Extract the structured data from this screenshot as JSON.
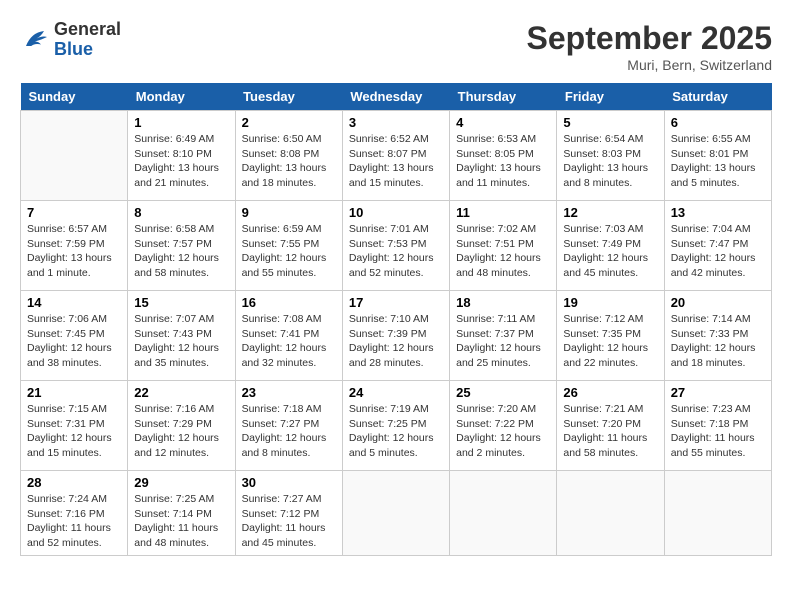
{
  "header": {
    "logo_general": "General",
    "logo_blue": "Blue",
    "month_title": "September 2025",
    "location": "Muri, Bern, Switzerland"
  },
  "days_of_week": [
    "Sunday",
    "Monday",
    "Tuesday",
    "Wednesday",
    "Thursday",
    "Friday",
    "Saturday"
  ],
  "weeks": [
    [
      {
        "date": "",
        "info": ""
      },
      {
        "date": "1",
        "info": "Sunrise: 6:49 AM\nSunset: 8:10 PM\nDaylight: 13 hours\nand 21 minutes."
      },
      {
        "date": "2",
        "info": "Sunrise: 6:50 AM\nSunset: 8:08 PM\nDaylight: 13 hours\nand 18 minutes."
      },
      {
        "date": "3",
        "info": "Sunrise: 6:52 AM\nSunset: 8:07 PM\nDaylight: 13 hours\nand 15 minutes."
      },
      {
        "date": "4",
        "info": "Sunrise: 6:53 AM\nSunset: 8:05 PM\nDaylight: 13 hours\nand 11 minutes."
      },
      {
        "date": "5",
        "info": "Sunrise: 6:54 AM\nSunset: 8:03 PM\nDaylight: 13 hours\nand 8 minutes."
      },
      {
        "date": "6",
        "info": "Sunrise: 6:55 AM\nSunset: 8:01 PM\nDaylight: 13 hours\nand 5 minutes."
      }
    ],
    [
      {
        "date": "7",
        "info": "Sunrise: 6:57 AM\nSunset: 7:59 PM\nDaylight: 13 hours\nand 1 minute."
      },
      {
        "date": "8",
        "info": "Sunrise: 6:58 AM\nSunset: 7:57 PM\nDaylight: 12 hours\nand 58 minutes."
      },
      {
        "date": "9",
        "info": "Sunrise: 6:59 AM\nSunset: 7:55 PM\nDaylight: 12 hours\nand 55 minutes."
      },
      {
        "date": "10",
        "info": "Sunrise: 7:01 AM\nSunset: 7:53 PM\nDaylight: 12 hours\nand 52 minutes."
      },
      {
        "date": "11",
        "info": "Sunrise: 7:02 AM\nSunset: 7:51 PM\nDaylight: 12 hours\nand 48 minutes."
      },
      {
        "date": "12",
        "info": "Sunrise: 7:03 AM\nSunset: 7:49 PM\nDaylight: 12 hours\nand 45 minutes."
      },
      {
        "date": "13",
        "info": "Sunrise: 7:04 AM\nSunset: 7:47 PM\nDaylight: 12 hours\nand 42 minutes."
      }
    ],
    [
      {
        "date": "14",
        "info": "Sunrise: 7:06 AM\nSunset: 7:45 PM\nDaylight: 12 hours\nand 38 minutes."
      },
      {
        "date": "15",
        "info": "Sunrise: 7:07 AM\nSunset: 7:43 PM\nDaylight: 12 hours\nand 35 minutes."
      },
      {
        "date": "16",
        "info": "Sunrise: 7:08 AM\nSunset: 7:41 PM\nDaylight: 12 hours\nand 32 minutes."
      },
      {
        "date": "17",
        "info": "Sunrise: 7:10 AM\nSunset: 7:39 PM\nDaylight: 12 hours\nand 28 minutes."
      },
      {
        "date": "18",
        "info": "Sunrise: 7:11 AM\nSunset: 7:37 PM\nDaylight: 12 hours\nand 25 minutes."
      },
      {
        "date": "19",
        "info": "Sunrise: 7:12 AM\nSunset: 7:35 PM\nDaylight: 12 hours\nand 22 minutes."
      },
      {
        "date": "20",
        "info": "Sunrise: 7:14 AM\nSunset: 7:33 PM\nDaylight: 12 hours\nand 18 minutes."
      }
    ],
    [
      {
        "date": "21",
        "info": "Sunrise: 7:15 AM\nSunset: 7:31 PM\nDaylight: 12 hours\nand 15 minutes."
      },
      {
        "date": "22",
        "info": "Sunrise: 7:16 AM\nSunset: 7:29 PM\nDaylight: 12 hours\nand 12 minutes."
      },
      {
        "date": "23",
        "info": "Sunrise: 7:18 AM\nSunset: 7:27 PM\nDaylight: 12 hours\nand 8 minutes."
      },
      {
        "date": "24",
        "info": "Sunrise: 7:19 AM\nSunset: 7:25 PM\nDaylight: 12 hours\nand 5 minutes."
      },
      {
        "date": "25",
        "info": "Sunrise: 7:20 AM\nSunset: 7:22 PM\nDaylight: 12 hours\nand 2 minutes."
      },
      {
        "date": "26",
        "info": "Sunrise: 7:21 AM\nSunset: 7:20 PM\nDaylight: 11 hours\nand 58 minutes."
      },
      {
        "date": "27",
        "info": "Sunrise: 7:23 AM\nSunset: 7:18 PM\nDaylight: 11 hours\nand 55 minutes."
      }
    ],
    [
      {
        "date": "28",
        "info": "Sunrise: 7:24 AM\nSunset: 7:16 PM\nDaylight: 11 hours\nand 52 minutes."
      },
      {
        "date": "29",
        "info": "Sunrise: 7:25 AM\nSunset: 7:14 PM\nDaylight: 11 hours\nand 48 minutes."
      },
      {
        "date": "30",
        "info": "Sunrise: 7:27 AM\nSunset: 7:12 PM\nDaylight: 11 hours\nand 45 minutes."
      },
      {
        "date": "",
        "info": ""
      },
      {
        "date": "",
        "info": ""
      },
      {
        "date": "",
        "info": ""
      },
      {
        "date": "",
        "info": ""
      }
    ]
  ]
}
